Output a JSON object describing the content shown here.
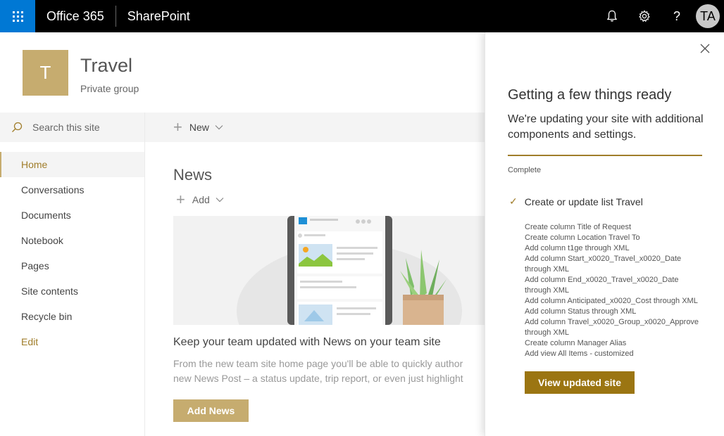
{
  "suitebar": {
    "app_name": "Office 365",
    "product": "SharePoint",
    "avatar_initials": "TA",
    "waffle_color": "#0078d4",
    "icons": [
      "waffle-icon",
      "bell-icon",
      "gear-icon",
      "help-icon"
    ],
    "help_glyph": "?"
  },
  "site": {
    "logo_letter": "T",
    "title": "Travel",
    "subtitle": "Private group",
    "accent_color": "#c6ac6f"
  },
  "search": {
    "placeholder": "Search this site"
  },
  "nav": {
    "items": [
      "Home",
      "Conversations",
      "Documents",
      "Notebook",
      "Pages",
      "Site contents",
      "Recycle bin"
    ],
    "selected": "Home",
    "edit_label": "Edit"
  },
  "command_bar": {
    "new_label": "New"
  },
  "news": {
    "title": "News",
    "add_label": "Add",
    "headline": "Keep your team updated with News on your team site",
    "description_line1": "From the new team site home page you'll be able to quickly author",
    "description_line2": "new News Post – a status update, trip report, or even just highlight",
    "add_news_button": "Add News"
  },
  "panel": {
    "title": "Getting a few things ready",
    "subtitle": "We're updating your site with additional components and settings.",
    "progress_label": "Complete",
    "progress_fraction": 1.0,
    "step_label": "Create or update list Travel",
    "details": [
      "Create column Title of Request",
      "Create column Location Travel To",
      "Add column t1ge through XML",
      "Add column Start_x0020_Travel_x0020_Date through XML",
      "Add column End_x0020_Travel_x0020_Date through XML",
      "Add column Anticipated_x0020_Cost through XML",
      "Add column Status through XML",
      "Add column Travel_x0020_Group_x0020_Approve through XML",
      "Create column Manager Alias",
      "Add view All Items - customized"
    ],
    "view_button": "View updated site",
    "button_color": "#9b7512"
  }
}
